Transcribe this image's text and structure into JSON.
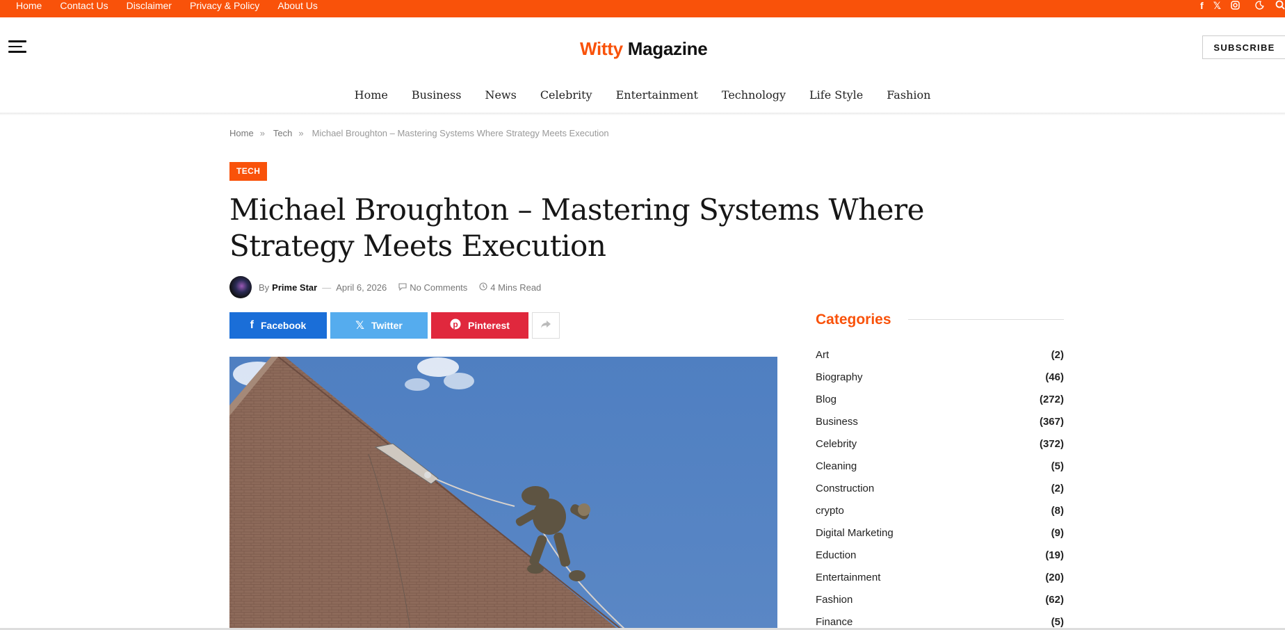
{
  "topbar": {
    "links": [
      "Home",
      "Contact Us",
      "Disclaimer",
      "Privacy & Policy",
      "About Us"
    ],
    "icons": [
      "facebook-icon",
      "x-icon",
      "instagram-icon",
      "dark-mode-icon",
      "search-icon"
    ],
    "accent": "#f9520a"
  },
  "header": {
    "logo_part1": "Witty",
    "logo_part2": "Magazine",
    "subscribe": "SUBSCRIBE"
  },
  "nav": {
    "items": [
      "Home",
      "Business",
      "News",
      "Celebrity",
      "Entertainment",
      "Technology",
      "Life Style",
      "Fashion"
    ]
  },
  "breadcrumb": {
    "home": "Home",
    "sep": "»",
    "section": "Tech",
    "current": "Michael Broughton – Mastering Systems Where Strategy Meets Execution"
  },
  "article": {
    "category": "TECH",
    "title": "Michael Broughton – Mastering Systems Where Strategy Meets Execution",
    "by": "By",
    "author": "Prime Star",
    "dash": "—",
    "date": "April 6, 2026",
    "comments": "No Comments",
    "read_time": "4 Mins Read"
  },
  "share": {
    "facebook": "Facebook",
    "twitter": "Twitter",
    "pinterest": "Pinterest",
    "colors": {
      "facebook": "#1a6ed8",
      "twitter": "#55acee",
      "pinterest": "#e0283d"
    }
  },
  "sidebar": {
    "title": "Categories",
    "categories": [
      {
        "name": "Art",
        "count": "(2)"
      },
      {
        "name": "Biography",
        "count": "(46)"
      },
      {
        "name": "Blog",
        "count": "(272)"
      },
      {
        "name": "Business",
        "count": "(367)"
      },
      {
        "name": "Celebrity",
        "count": "(372)"
      },
      {
        "name": "Cleaning",
        "count": "(5)"
      },
      {
        "name": "Construction",
        "count": "(2)"
      },
      {
        "name": "crypto",
        "count": "(8)"
      },
      {
        "name": "Digital Marketing",
        "count": "(9)"
      },
      {
        "name": "Eduction",
        "count": "(19)"
      },
      {
        "name": "Entertainment",
        "count": "(20)"
      },
      {
        "name": "Fashion",
        "count": "(62)"
      },
      {
        "name": "Finance",
        "count": "(5)"
      }
    ]
  }
}
